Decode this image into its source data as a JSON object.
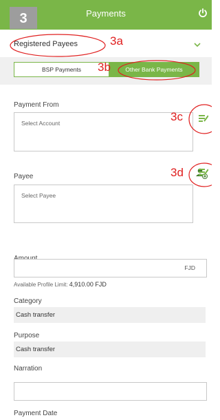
{
  "step": "3",
  "header": {
    "title": "Payments"
  },
  "payee_type": {
    "selected": "Registered Payees"
  },
  "tabs": [
    {
      "label": "BSP Payments"
    },
    {
      "label": "Other Bank Payments"
    }
  ],
  "annotations": {
    "a": "3a",
    "b": "3b",
    "c": "3c",
    "d": "3d"
  },
  "payment_from": {
    "label": "Payment From",
    "placeholder": "Select Account"
  },
  "payee": {
    "label": "Payee",
    "placeholder": "Select Payee"
  },
  "amount": {
    "label": "Amount",
    "currency": "FJD",
    "limit_label": "Available Profile Limit:",
    "limit_value": "4,910.00 FJD"
  },
  "category": {
    "label": "Category",
    "value": "Cash transfer"
  },
  "purpose": {
    "label": "Purpose",
    "value": "Cash transfer"
  },
  "narration": {
    "label": "Narration"
  },
  "payment_date": {
    "label": "Payment Date"
  },
  "colors": {
    "accent": "#7ab648",
    "annotation": "#e02020",
    "badge": "#9d9d9d"
  },
  "icons": {
    "power": "power-icon",
    "chevron": "chevron-down-icon",
    "list": "list-select-icon",
    "add_user": "add-user-icon"
  }
}
